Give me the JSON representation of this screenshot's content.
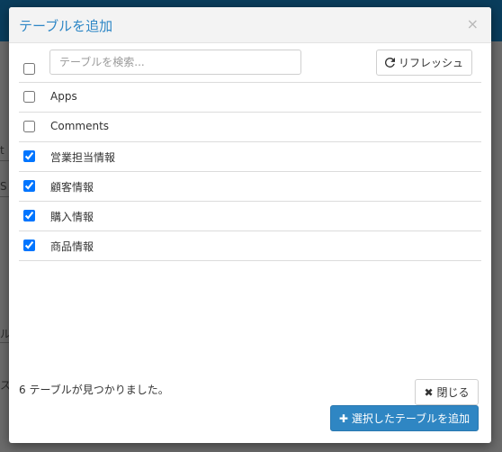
{
  "background": {
    "fragments": [
      "t",
      "S",
      "ル",
      "ス"
    ]
  },
  "modal": {
    "title": "テーブルを追加",
    "close_symbol": "×"
  },
  "search": {
    "placeholder": "テーブルを検索...",
    "select_all_checked": false
  },
  "refresh_button": {
    "label": "リフレッシュ",
    "icon": "refresh-icon"
  },
  "tables": [
    {
      "label": "Apps",
      "checked": false
    },
    {
      "label": "Comments",
      "checked": false
    },
    {
      "label": "営業担当情報",
      "checked": true
    },
    {
      "label": "顧客情報",
      "checked": true
    },
    {
      "label": "購入情報",
      "checked": true
    },
    {
      "label": "商品情報",
      "checked": true
    }
  ],
  "status": "6 テーブルが見つかりました。",
  "close_button": {
    "label": "閉じる",
    "icon": "close-icon"
  },
  "add_button": {
    "label": "選択したテーブルを追加",
    "icon": "plus-icon"
  },
  "colors": {
    "accent": "#2f86c3",
    "title": "#2e87c6"
  }
}
